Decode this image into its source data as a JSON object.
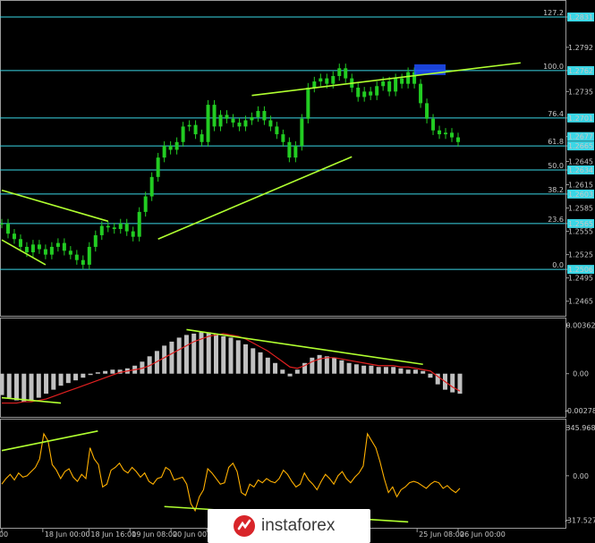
{
  "watermark": {
    "brand": "instaforex"
  },
  "colors": {
    "background": "#000000",
    "grid": "#ffffff",
    "candle": "#22cc22",
    "fib": "#3ad7e6",
    "trend": "#b0ff30",
    "hist": "#c0c0c0",
    "signal": "#e02020",
    "osc": "#ffb000",
    "marker": "#1f4fff"
  },
  "chart_data": [
    {
      "type": "candlestick",
      "title": "",
      "ylim": [
        1.2452,
        1.2846
      ],
      "yticks": [
        {
          "v": 1.2831,
          "label": "1.2831",
          "boxed": true
        },
        {
          "v": 1.2792,
          "label": "1.2792"
        },
        {
          "v": 1.2762,
          "label": "1.2762",
          "boxed": true
        },
        {
          "v": 1.2735,
          "label": "1.2735"
        },
        {
          "v": 1.2701,
          "label": "1.2701",
          "boxed": true
        },
        {
          "v": 1.2677,
          "label": "1.2677",
          "boxed": true
        },
        {
          "v": 1.2665,
          "label": "1.2665",
          "boxed": true
        },
        {
          "v": 1.2645,
          "label": "1.2645"
        },
        {
          "v": 1.2634,
          "label": "1.2634",
          "boxed": true
        },
        {
          "v": 1.2615,
          "label": "1.2615"
        },
        {
          "v": 1.2603,
          "label": "1.2603",
          "boxed": true
        },
        {
          "v": 1.2585,
          "label": "1.2585"
        },
        {
          "v": 1.2565,
          "label": "1.2565",
          "boxed": true
        },
        {
          "v": 1.2555,
          "label": "1.2555"
        },
        {
          "v": 1.2525,
          "label": "1.2525"
        },
        {
          "v": 1.2506,
          "label": "1.2506",
          "boxed": true
        },
        {
          "v": 1.2495,
          "label": "1.2495"
        },
        {
          "v": 1.2465,
          "label": "1.2465"
        }
      ],
      "fib_levels": [
        {
          "label": "127.2",
          "v": 1.2831
        },
        {
          "label": "100.0",
          "v": 1.2762
        },
        {
          "label": "76.4",
          "v": 1.2701
        },
        {
          "label": "61.8",
          "v": 1.2665
        },
        {
          "label": "50.0",
          "v": 1.2634
        },
        {
          "label": "38.2",
          "v": 1.2603
        },
        {
          "label": "23.6",
          "v": 1.2565
        },
        {
          "label": "0.0",
          "v": 1.2506
        }
      ],
      "close_series": [
        1.2565,
        1.2552,
        1.2545,
        1.2535,
        1.2528,
        1.2538,
        1.2532,
        1.2525,
        1.2535,
        1.254,
        1.253,
        1.2525,
        1.2518,
        1.2512,
        1.2535,
        1.255,
        1.2562,
        1.256,
        1.2558,
        1.2565,
        1.2555,
        1.2548,
        1.258,
        1.26,
        1.2625,
        1.265,
        1.2665,
        1.266,
        1.267,
        1.269,
        1.2692,
        1.268,
        1.267,
        1.2718,
        1.269,
        1.2705,
        1.27,
        1.2695,
        1.269,
        1.2698,
        1.2702,
        1.271,
        1.2698,
        1.269,
        1.268,
        1.267,
        1.265,
        1.2665,
        1.27,
        1.274,
        1.2748,
        1.2752,
        1.2745,
        1.2755,
        1.2765,
        1.2752,
        1.274,
        1.2728,
        1.2735,
        1.273,
        1.2742,
        1.2748,
        1.2735,
        1.2752,
        1.2745,
        1.276,
        1.2745,
        1.272,
        1.27,
        1.2685,
        1.268,
        1.2682,
        1.2676,
        1.267
      ],
      "trendlines": [
        {
          "from": [
            0,
            1.2608
          ],
          "to": [
            17,
            1.2568
          ]
        },
        {
          "from": [
            0,
            1.2544
          ],
          "to": [
            7,
            1.2512
          ]
        },
        {
          "from": [
            25,
            1.2545
          ],
          "to": [
            56,
            1.2651
          ]
        },
        {
          "from": [
            40,
            1.273
          ],
          "to": [
            83,
            1.2772
          ]
        }
      ],
      "marker": {
        "from": 66,
        "to": 71,
        "v": 1.2762
      }
    },
    {
      "type": "macd",
      "yticks": [
        {
          "v": 0.00362,
          "label": "0.00362"
        },
        {
          "v": 0.0,
          "label": "0.00"
        },
        {
          "v": -0.00278,
          "label": "-0.00278"
        }
      ],
      "ylim": [
        -0.0029,
        0.0038
      ],
      "histogram": [
        -0.0016,
        -0.0018,
        -0.002,
        -0.0021,
        -0.002,
        -0.0018,
        -0.0015,
        -0.0012,
        -0.0009,
        -0.0007,
        -0.0005,
        -0.0003,
        -0.0001,
        0.0001,
        0.0002,
        0.0003,
        0.0003,
        0.0004,
        0.0006,
        0.0009,
        0.0013,
        0.0017,
        0.0021,
        0.0024,
        0.0027,
        0.0029,
        0.003,
        0.0031,
        0.0031,
        0.003,
        0.0028,
        0.0027,
        0.0025,
        0.0022,
        0.0019,
        0.0016,
        0.0012,
        0.0008,
        0.0003,
        -0.0002,
        0.0003,
        0.0008,
        0.0012,
        0.0014,
        0.0013,
        0.0012,
        0.001,
        0.0008,
        0.0007,
        0.0006,
        0.0006,
        0.0005,
        0.0005,
        0.0005,
        0.0004,
        0.0003,
        0.0003,
        0.0002,
        -0.0003,
        -0.0008,
        -0.0012,
        -0.0014,
        -0.0015
      ],
      "signal": [
        -0.0022,
        -0.0022,
        -0.0022,
        -0.0021,
        -0.0021,
        -0.002,
        -0.0019,
        -0.0017,
        -0.0015,
        -0.0013,
        -0.0011,
        -0.0009,
        -0.0007,
        -0.0005,
        -0.0003,
        -0.0001,
        0.0001,
        0.0002,
        0.0003,
        0.0004,
        0.0006,
        0.0009,
        0.0012,
        0.0015,
        0.0018,
        0.0021,
        0.0024,
        0.0026,
        0.0028,
        0.0029,
        0.003,
        0.0029,
        0.0028,
        0.0026,
        0.0023,
        0.002,
        0.0017,
        0.0013,
        0.0009,
        0.0005,
        0.0004,
        0.0006,
        0.0009,
        0.0011,
        0.0012,
        0.0012,
        0.0011,
        0.001,
        0.0009,
        0.0008,
        0.0007,
        0.0006,
        0.0006,
        0.0006,
        0.0005,
        0.0005,
        0.0004,
        0.0003,
        0.0002,
        -0.0002,
        -0.0006,
        -0.001,
        -0.0013
      ],
      "trendlines": [
        {
          "from": [
            0,
            -0.0018
          ],
          "to": [
            8,
            -0.0022
          ]
        },
        {
          "from": [
            25,
            0.0033
          ],
          "to": [
            57,
            0.0007
          ]
        }
      ]
    },
    {
      "type": "line",
      "yticks": [
        {
          "v": 345.968,
          "label": "345.968"
        },
        {
          "v": 0.0,
          "label": "0.00"
        },
        {
          "v": -317.527,
          "label": "-317.527"
        }
      ],
      "ylim": [
        -340,
        370
      ],
      "series": [
        {
          "values": [
            -60,
            -20,
            10,
            -30,
            20,
            -10,
            0,
            30,
            60,
            120,
            300,
            250,
            80,
            40,
            -20,
            30,
            50,
            -10,
            -40,
            10,
            -20,
            200,
            120,
            80,
            -80,
            -60,
            40,
            60,
            90,
            40,
            20,
            60,
            30,
            -10,
            20,
            -40,
            -60,
            -20,
            -10,
            60,
            40,
            -30,
            -20,
            -10,
            -60,
            -200,
            -250,
            -150,
            -100,
            50,
            20,
            -20,
            -60,
            -50,
            60,
            90,
            30,
            -120,
            -140,
            -60,
            -80,
            -30,
            -50,
            -20,
            -40,
            -50,
            -20,
            40,
            10,
            -40,
            -80,
            -60,
            20,
            -30,
            -60,
            -100,
            -40,
            10,
            -20,
            -60,
            0,
            30,
            -20,
            -50,
            -10,
            20,
            70,
            300,
            250,
            200,
            100,
            -20,
            -120,
            -80,
            -150,
            -100,
            -80,
            -50,
            -40,
            -50,
            -70,
            -90,
            -60,
            -40,
            -50,
            -90,
            -70,
            -100,
            -120,
            -90
          ]
        }
      ],
      "trendlines": [
        {
          "from": [
            0,
            180
          ],
          "to": [
            13,
            320
          ]
        },
        {
          "from": [
            22,
            -220
          ],
          "to": [
            55,
            -330
          ]
        }
      ]
    }
  ],
  "x_axis": {
    "ticks": [
      {
        "i": 0,
        "label": "00"
      },
      {
        "i": 8,
        "label": "18 Jun 00:00"
      },
      {
        "i": 17,
        "label": "18 Jun 16:00"
      },
      {
        "i": 25,
        "label": "19 Jun 08:00"
      },
      {
        "i": 33,
        "label": "20 Jun 00:00"
      },
      {
        "i": 40,
        "label": "20"
      },
      {
        "i": 81,
        "label": "25 Jun 08:00"
      },
      {
        "i": 89,
        "label": "26 Jun 00:00"
      }
    ],
    "span": 89
  }
}
